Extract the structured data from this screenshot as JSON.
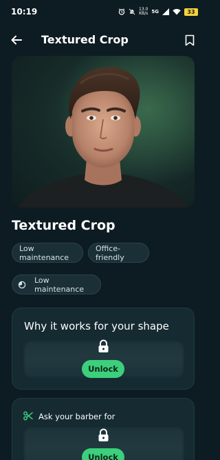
{
  "status_bar": {
    "time": "10:19",
    "net_speed_value": "13.0",
    "net_speed_unit": "KB/s",
    "network_type": "5G",
    "battery": "33"
  },
  "app_bar": {
    "title": "Textured Crop"
  },
  "style": {
    "name": "Textured Crop",
    "tags": [
      "Low maintenance",
      "Office-friendly"
    ],
    "maintenance_label": "Low maintenance"
  },
  "sections": {
    "why_title": "Why it works for your shape",
    "ask_barber_title": "Ask your barber for",
    "unlock_label": "Unlock"
  },
  "colors": {
    "background": "#0d1c22",
    "accent": "#3ccf7c",
    "card": "#152a31",
    "chip": "#1b2f37"
  }
}
